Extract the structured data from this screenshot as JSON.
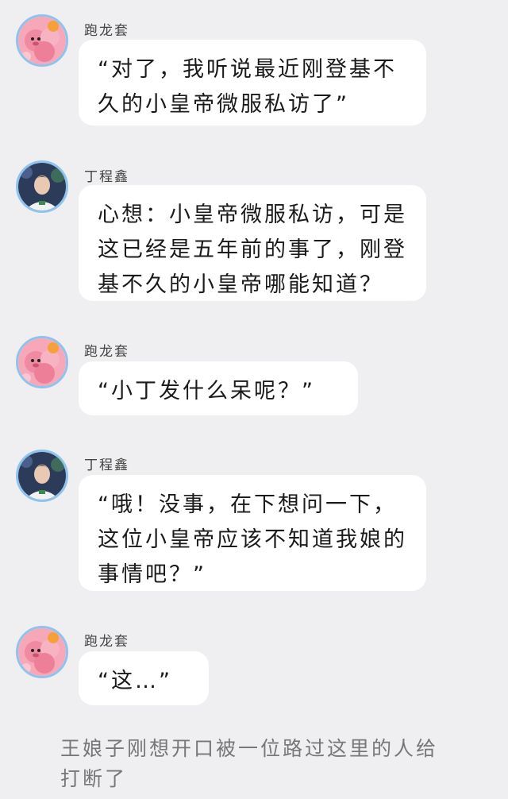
{
  "messages": [
    {
      "sender": "跑龙套",
      "avatar": "pink-plush-avatar",
      "text": "“对了，我听说最近刚登基不久的小皇帝微服私访了”"
    },
    {
      "sender": "丁程鑫",
      "avatar": "boy-photo-avatar",
      "text": "心想：小皇帝微服私访，可是这已经是五年前的事了，刚登基不久的小皇帝哪能知道？"
    },
    {
      "sender": "跑龙套",
      "avatar": "pink-plush-avatar",
      "text": "“小丁发什么呆呢？”"
    },
    {
      "sender": "丁程鑫",
      "avatar": "boy-photo-avatar",
      "text": "“哦！没事，在下想问一下，这位小皇帝应该不知道我娘的事情吧？”"
    },
    {
      "sender": "跑龙套",
      "avatar": "pink-plush-avatar",
      "text": "“这…”"
    }
  ],
  "narration": "王娘子刚想开口被一位路过这里的人给打断了",
  "colors": {
    "background": "#efeff1",
    "bubble": "#ffffff",
    "avatar_ring": "#8fc3ec",
    "narration": "#777777"
  }
}
